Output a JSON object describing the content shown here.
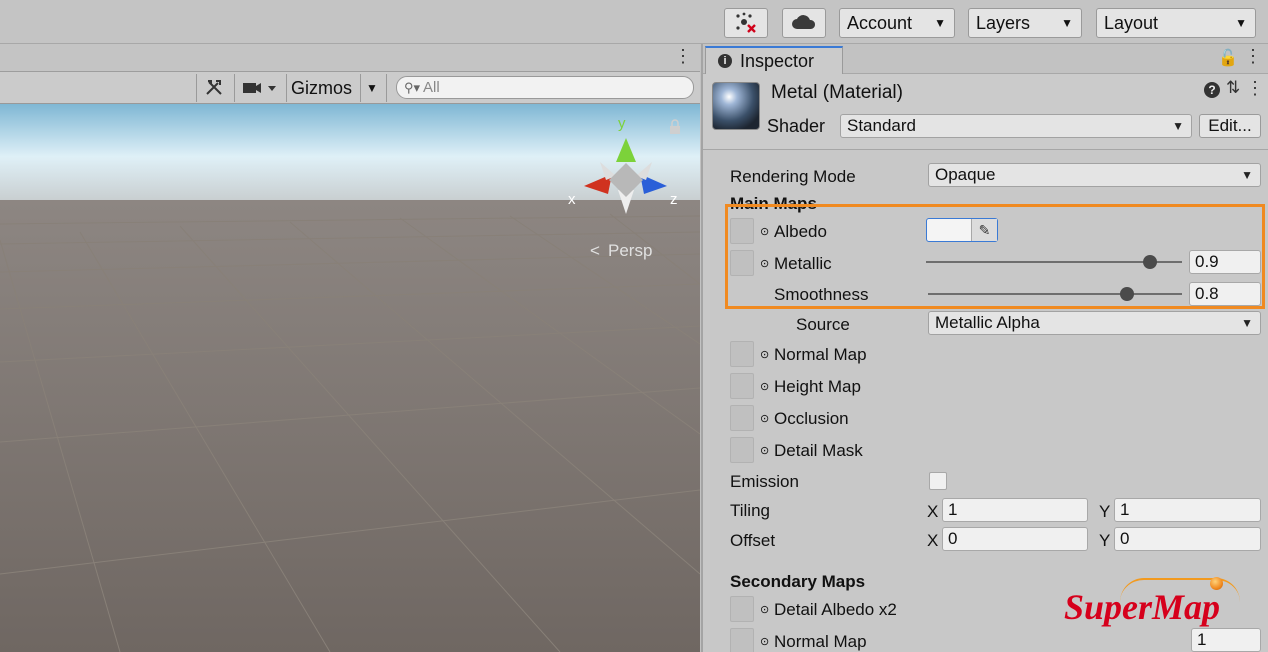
{
  "toolbar": {
    "account_label": "Account",
    "layers_label": "Layers",
    "layout_label": "Layout",
    "collab_icon": "collab-icon",
    "cloud_icon": "cloud-icon"
  },
  "scene": {
    "gizmos_label": "Gizmos",
    "search_placeholder": "All",
    "persp_label": "Persp",
    "axis_y": "y",
    "axis_x": "x",
    "axis_z": "z"
  },
  "inspector": {
    "tab_label": "Inspector",
    "material_name": "Metal (Material)",
    "shader_label": "Shader",
    "shader_value": "Standard",
    "edit_label": "Edit...",
    "rendering_mode_label": "Rendering Mode",
    "rendering_mode_value": "Opaque",
    "main_maps_label": "Main Maps",
    "albedo_label": "Albedo",
    "metallic_label": "Metallic",
    "metallic_value": "0.9",
    "smoothness_label": "Smoothness",
    "smoothness_value": "0.8",
    "source_label": "Source",
    "source_value": "Metallic Alpha",
    "normal_map_label": "Normal Map",
    "height_map_label": "Height Map",
    "occlusion_label": "Occlusion",
    "detail_mask_label": "Detail Mask",
    "emission_label": "Emission",
    "tiling_label": "Tiling",
    "tiling_x_label": "X",
    "tiling_x": "1",
    "tiling_y_label": "Y",
    "tiling_y": "1",
    "offset_label": "Offset",
    "offset_x_label": "X",
    "offset_x": "0",
    "offset_y_label": "Y",
    "offset_y": "0",
    "secondary_maps_label": "Secondary Maps",
    "detail_albedo_label": "Detail Albedo x2",
    "secondary_normal_label": "Normal Map",
    "secondary_normal_value": "1"
  },
  "watermark": {
    "logo_text": "SuperMap"
  },
  "colors": {
    "highlight": "#f08a21",
    "accent": "#3a7ad5",
    "logo_red": "#d6001c"
  }
}
